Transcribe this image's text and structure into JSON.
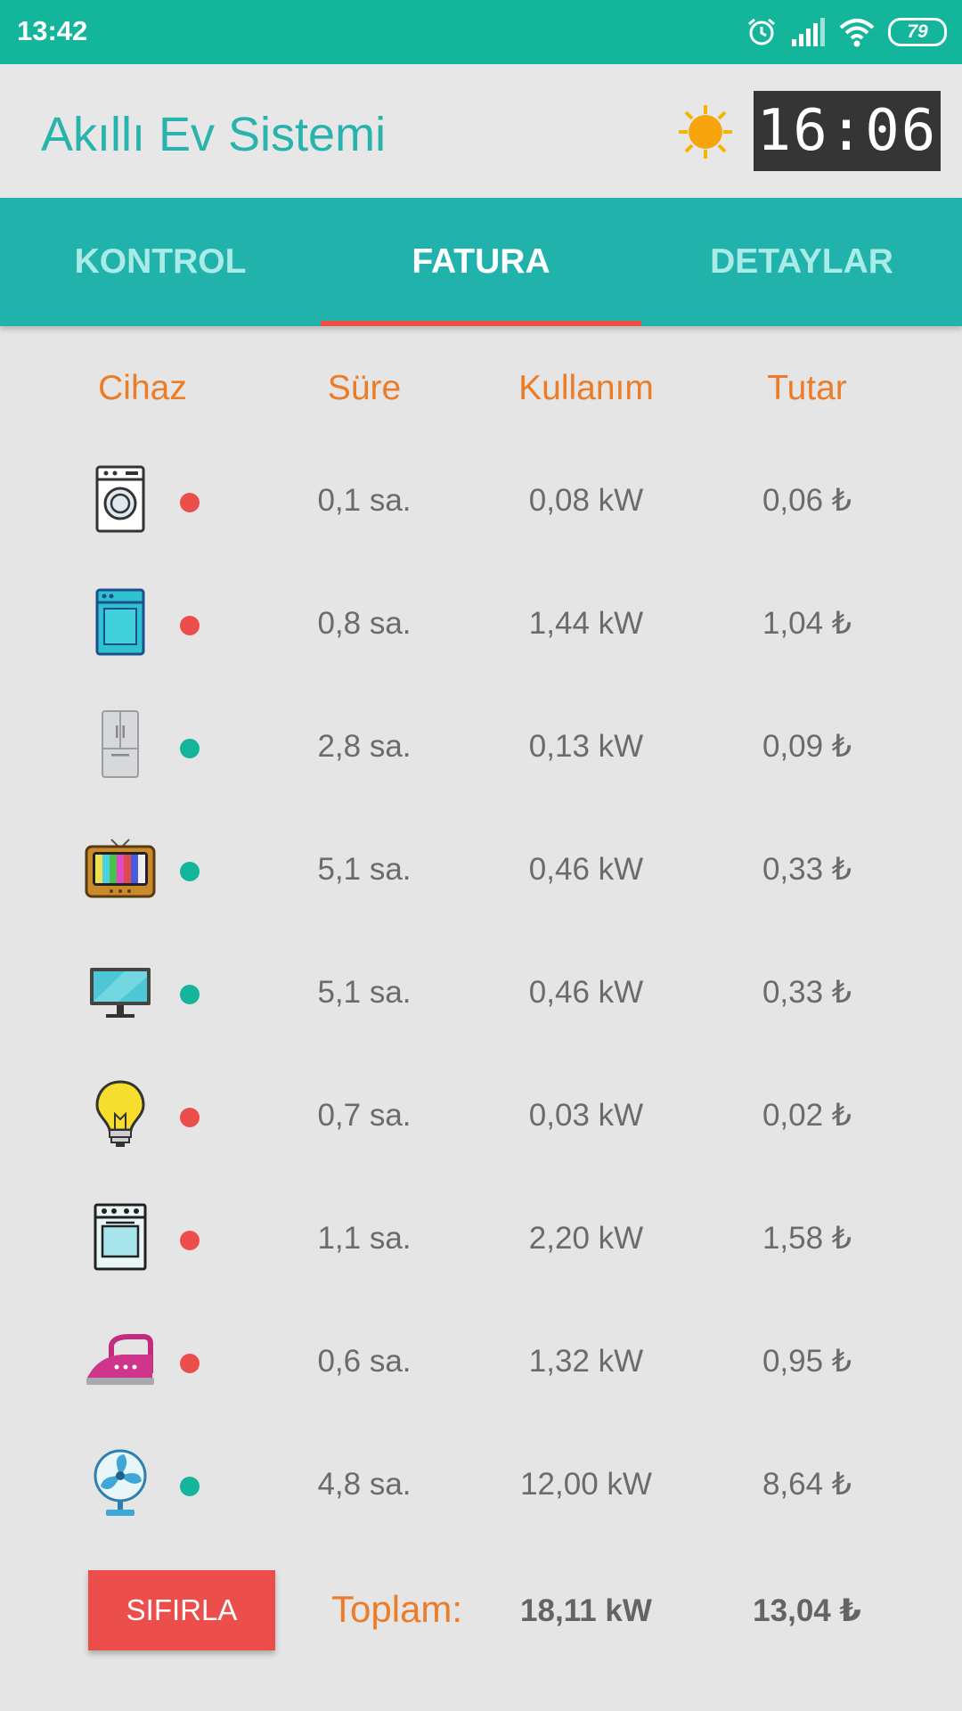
{
  "status_bar": {
    "time": "13:42",
    "battery": "79"
  },
  "header": {
    "title": "Akıllı Ev Sistemi",
    "clock": "16:06"
  },
  "tabs": [
    {
      "label": "KONTROL"
    },
    {
      "label": "FATURA",
      "active": true
    },
    {
      "label": "DETAYLAR"
    }
  ],
  "table": {
    "headers": [
      "Cihaz",
      "Süre",
      "Kullanım",
      "Tutar"
    ],
    "rows": [
      {
        "device_icon": "washing-machine-icon",
        "status": "off",
        "duration": "0,1 sa.",
        "usage": "0,08 kW",
        "cost": "0,06 ₺"
      },
      {
        "device_icon": "dishwasher-icon",
        "status": "off",
        "duration": "0,8 sa.",
        "usage": "1,44 kW",
        "cost": "1,04 ₺"
      },
      {
        "device_icon": "refrigerator-icon",
        "status": "on",
        "duration": "2,8 sa.",
        "usage": "0,13 kW",
        "cost": "0,09 ₺"
      },
      {
        "device_icon": "retro-tv-icon",
        "status": "on",
        "duration": "5,1 sa.",
        "usage": "0,46 kW",
        "cost": "0,33 ₺"
      },
      {
        "device_icon": "monitor-icon",
        "status": "on",
        "duration": "5,1 sa.",
        "usage": "0,46 kW",
        "cost": "0,33 ₺"
      },
      {
        "device_icon": "light-bulb-icon",
        "status": "off",
        "duration": "0,7 sa.",
        "usage": "0,03 kW",
        "cost": "0,02 ₺"
      },
      {
        "device_icon": "oven-icon",
        "status": "off",
        "duration": "1,1 sa.",
        "usage": "2,20 kW",
        "cost": "1,58 ₺"
      },
      {
        "device_icon": "iron-icon",
        "status": "off",
        "duration": "0,6 sa.",
        "usage": "1,32 kW",
        "cost": "0,95 ₺"
      },
      {
        "device_icon": "fan-icon",
        "status": "on",
        "duration": "4,8 sa.",
        "usage": "12,00 kW",
        "cost": "8,64 ₺"
      }
    ]
  },
  "footer": {
    "reset_label": "SIFIRLA",
    "total_label": "Toplam:",
    "total_usage": "18,11 kW",
    "total_cost": "13,04 ₺"
  },
  "colors": {
    "accent": "#22b2ac",
    "status_bar": "#13b59b",
    "header_text": "#ed7c26",
    "status_on": "#13b59b",
    "status_off": "#ec4e4c",
    "reset_button": "#ec4e4c"
  }
}
